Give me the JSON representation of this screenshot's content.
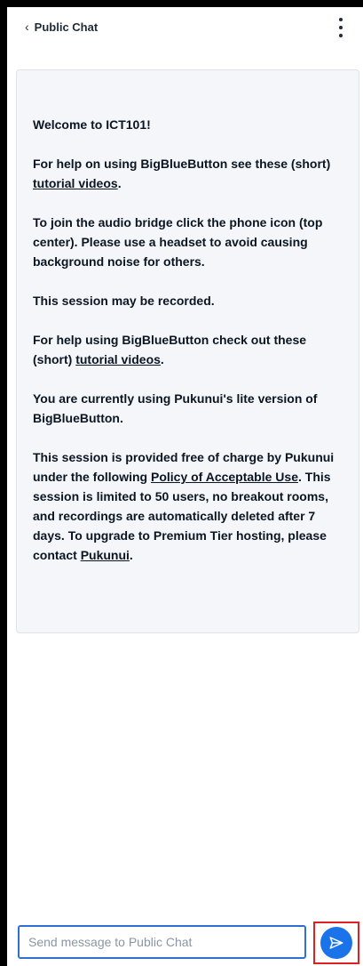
{
  "header": {
    "back_label": "Public Chat",
    "icons": {
      "back": "chevron-left-icon",
      "menu": "more-vertical-icon"
    }
  },
  "welcome": {
    "title": "Welcome to ICT101!",
    "help1_prefix": "For help on using BigBlueButton see these (short) ",
    "help1_link": "tutorial videos",
    "help1_suffix": ".",
    "audio": "To join the audio bridge click the phone icon (top center). Please use a headset to avoid causing background noise for others.",
    "recorded": "This session may be recorded.",
    "help2_prefix": "For help using BigBlueButton check out these (short) ",
    "help2_link": "tutorial videos",
    "help2_suffix": ".",
    "lite": "You are currently using Pukunui's lite version of BigBlueButton.",
    "terms_prefix": "This session is provided free of charge by Pukunui under the following ",
    "terms_link": "Policy of Acceptable Use",
    "terms_middle": ". This session is limited to 50 users, no breakout rooms, and recordings are automatically deleted after 7 days. To upgrade to Premium Tier hosting, please contact ",
    "contact_link": "Pukunui",
    "terms_suffix": "."
  },
  "composer": {
    "placeholder": "Send message to Public Chat",
    "value": "",
    "send_icon": "send-icon"
  },
  "colors": {
    "accent": "#1a73e8",
    "input_border": "#2f6fd6",
    "highlight": "#e02020"
  }
}
